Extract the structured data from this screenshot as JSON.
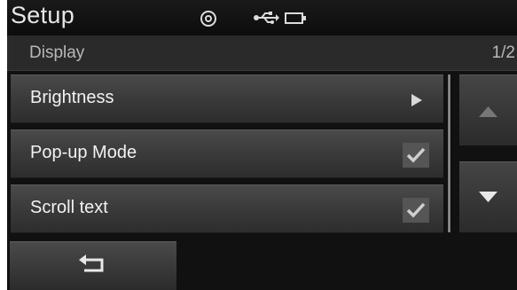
{
  "header": {
    "title": "Setup",
    "status_icons": [
      "disc-icon",
      "usb-icon",
      "battery-icon"
    ]
  },
  "subheader": {
    "title": "Display",
    "page": "1/2"
  },
  "menu": {
    "items": [
      {
        "label": "Brightness",
        "control": "arrow"
      },
      {
        "label": "Pop-up Mode",
        "control": "checkbox",
        "checked": true
      },
      {
        "label": "Scroll text",
        "control": "checkbox",
        "checked": true
      }
    ]
  },
  "scroll": {
    "up_state": "disabled",
    "down_state": "enabled"
  },
  "colors": {
    "background": "#111111",
    "row": "#3a3a3a",
    "text": "#f2f2f2",
    "check": "#cfcfcf"
  }
}
